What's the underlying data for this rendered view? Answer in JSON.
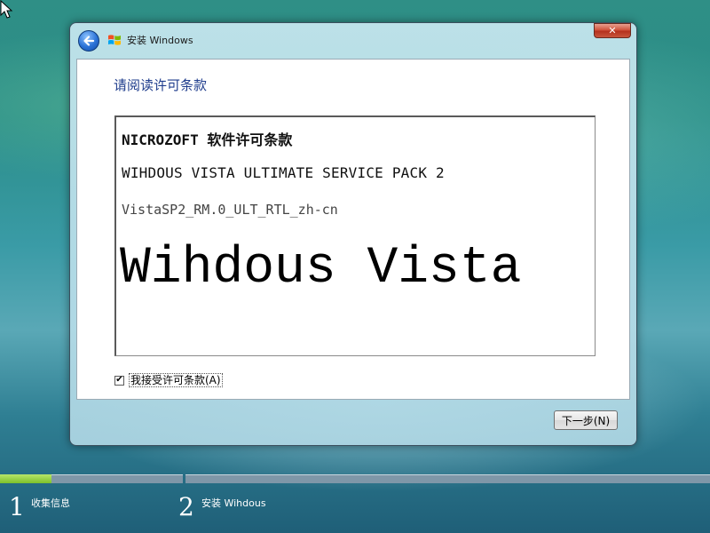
{
  "window": {
    "title": "安装 Windows",
    "close_label": "✕"
  },
  "page": {
    "heading": "请阅读许可条款"
  },
  "license": {
    "line1": "NICROZOFT 软件许可条款",
    "line2": "WIHDOUS VISTA ULTIMATE SERVICE PACK 2",
    "line3": "VistaSP2_RM.0_ULT_RTL_zh-cn",
    "big_text": "Wihdous Vista"
  },
  "accept": {
    "checked": true,
    "check_glyph": "✔",
    "label": "我接受许可条款(A)"
  },
  "footer": {
    "next_label": "下一步(N)"
  },
  "progress": {
    "steps": [
      {
        "number": "1",
        "label": "收集信息",
        "progress": 0.28
      },
      {
        "number": "2",
        "label": "安装 Wihdous",
        "progress": 0
      }
    ]
  },
  "colors": {
    "heading": "#1e3c8c",
    "progress_fill": "#7dc22a",
    "progress_track": "#7f97a8"
  },
  "icons": [
    "cursor-arrow-icon",
    "back-arrow-icon",
    "windows-flag-icon",
    "close-icon",
    "checkmark-icon"
  ]
}
